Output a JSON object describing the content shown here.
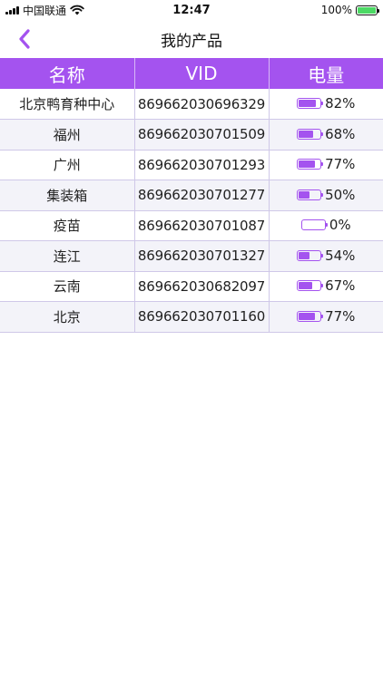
{
  "status_bar": {
    "carrier": "中国联通",
    "time": "12:47",
    "battery_text": "100%",
    "battery_fraction": 1.0
  },
  "nav": {
    "title": "我的产品",
    "back_icon": "chevron-left-icon"
  },
  "colors": {
    "accent": "#a453ef",
    "row_alt": "#f3f3f9",
    "border": "#cfc8e8"
  },
  "table": {
    "headers": [
      "名称",
      "VID",
      "电量"
    ],
    "rows": [
      {
        "name": "北京鸭育种中心",
        "vid": "869662030696329",
        "power": "82%",
        "level": 0.82
      },
      {
        "name": "福州",
        "vid": "869662030701509",
        "power": "68%",
        "level": 0.68
      },
      {
        "name": "广州",
        "vid": "869662030701293",
        "power": "77%",
        "level": 0.77
      },
      {
        "name": "集装箱",
        "vid": "869662030701277",
        "power": "50%",
        "level": 0.5
      },
      {
        "name": "疫苗",
        "vid": "869662030701087",
        "power": "0%",
        "level": 0.0
      },
      {
        "name": "连江",
        "vid": "869662030701327",
        "power": "54%",
        "level": 0.54
      },
      {
        "name": "云南",
        "vid": "869662030682097",
        "power": "67%",
        "level": 0.67
      },
      {
        "name": "北京",
        "vid": "869662030701160",
        "power": "77%",
        "level": 0.77
      }
    ]
  }
}
